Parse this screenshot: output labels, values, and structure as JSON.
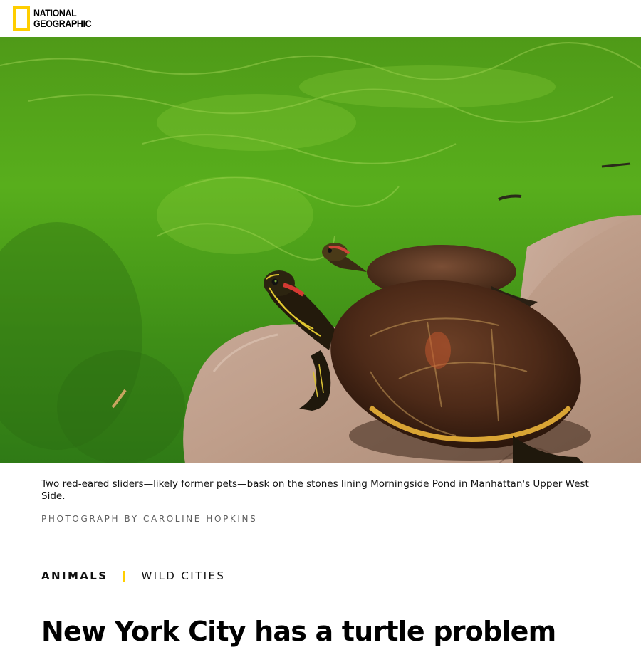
{
  "header": {
    "logo_line1": "NATIONAL",
    "logo_line2": "GEOGRAPHIC",
    "logo_color": "#ffce00"
  },
  "hero": {
    "scene": "two-turtles-basking-on-rock-by-green-pond"
  },
  "caption": {
    "text": "Two red-eared sliders—likely former pets—bask on the stones lining Morningside Pond in Manhattan's Upper West Side.",
    "credit": "PHOTOGRAPH BY CAROLINE HOPKINS"
  },
  "categories": {
    "primary": "ANIMALS",
    "secondary": "WILD CITIES",
    "separator_color": "#ffce00"
  },
  "article": {
    "title": "New York City has a turtle problem"
  }
}
